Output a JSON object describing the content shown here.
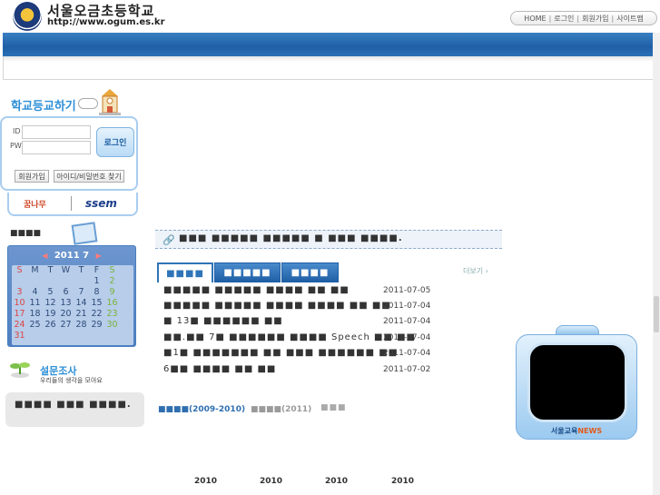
{
  "header": {
    "school_name": "서울오금초등학교",
    "school_url": "http://www.ogum.es.kr",
    "nav": [
      "HOME",
      "로그인",
      "회원가입",
      "사이트맵"
    ]
  },
  "login": {
    "title": "학교등교하기",
    "id_label": "ID",
    "pw_label": "PW",
    "login_button": "로그인",
    "signup_button": "회원가입",
    "find_button": "아이디/비밀번호 찾기",
    "banner_kids": "꿈나무",
    "banner_ssem": "ssem"
  },
  "calendar": {
    "title": "■■■■",
    "year": "2011",
    "month": "7",
    "weekdays": [
      "S",
      "M",
      "T",
      "W",
      "T",
      "F",
      "S"
    ],
    "weeks": [
      [
        "",
        "",
        "",
        "",
        "",
        "1",
        "2"
      ],
      [
        "3",
        "4",
        "5",
        "6",
        "7",
        "8",
        "9"
      ],
      [
        "10",
        "11",
        "12",
        "13",
        "14",
        "15",
        "16"
      ],
      [
        "17",
        "18",
        "19",
        "20",
        "21",
        "22",
        "23"
      ],
      [
        "24",
        "25",
        "26",
        "27",
        "28",
        "29",
        "30"
      ],
      [
        "31",
        "",
        "",
        "",
        "",
        "",
        ""
      ]
    ]
  },
  "survey": {
    "title": "설문조사",
    "subtitle": "우리들의 생각을 모아요",
    "text": "■■■■ ■■■ ■■■■."
  },
  "notice": {
    "text": "■■■ ■■■■■ ■■■■■ ■ ■■■ ■■■■."
  },
  "tabs": [
    "■■■■",
    "■■■■■",
    "■■■■"
  ],
  "more_label": "더보기 ›",
  "news": [
    {
      "title": "■■■■■ ■■■■■ ■■■■ ■■ ■■",
      "date": "2011-07-05"
    },
    {
      "title": "■■■■■ ■■■■■ ■■■■ ■■■■ ■■ ■■",
      "date": "2011-07-04"
    },
    {
      "title": "■ 13■ ■■■■■■ ■■",
      "date": "2011-07-04"
    },
    {
      "title": "■■.■■ 7■ ■■■■■■ ■■■■ Speech ■■ ■■",
      "date": "2011-07-04"
    },
    {
      "title": "■1■ ■■■■■■■ ■■ ■■■ ■■■■■■ ■■",
      "date": "2011-07-04"
    },
    {
      "title": "6■■ ■■■■ ■■ ■■",
      "date": "2011-07-02"
    }
  ],
  "years": {
    "active": "■■■■(2009-2010)",
    "inactive": "■■■■(2011)",
    "extra": "■■■",
    "bottom": [
      "2010",
      "2010",
      "2010",
      "2010"
    ]
  },
  "tv": {
    "label_prefix": "서울교육",
    "label_suffix": "NEWS"
  }
}
